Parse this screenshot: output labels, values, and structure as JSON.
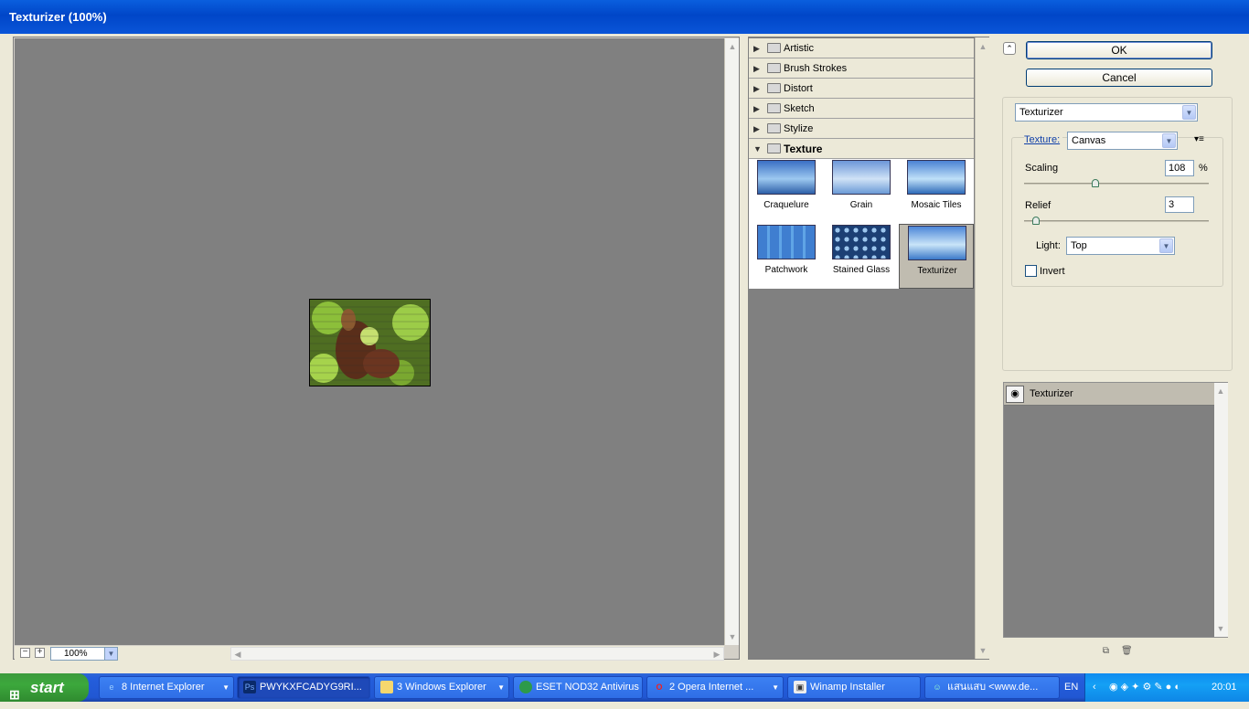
{
  "window": {
    "title": "Texturizer (100%)"
  },
  "preview": {
    "zoom": "100%"
  },
  "categories": [
    {
      "label": "Artistic"
    },
    {
      "label": "Brush Strokes"
    },
    {
      "label": "Distort"
    },
    {
      "label": "Sketch"
    },
    {
      "label": "Stylize"
    },
    {
      "label": "Texture"
    }
  ],
  "textures": [
    {
      "label": "Craquelure"
    },
    {
      "label": "Grain"
    },
    {
      "label": "Mosaic Tiles"
    },
    {
      "label": "Patchwork"
    },
    {
      "label": "Stained Glass"
    },
    {
      "label": "Texturizer"
    }
  ],
  "buttons": {
    "ok": "OK",
    "cancel": "Cancel"
  },
  "filter_select": {
    "value": "Texturizer"
  },
  "options": {
    "texture_label": "Texture:",
    "texture_value": "Canvas",
    "scaling_label": "Scaling",
    "scaling_value": "108",
    "scaling_unit": "%",
    "relief_label": "Relief",
    "relief_value": "3",
    "light_label": "Light:",
    "light_value": "Top",
    "invert_label": "Invert",
    "invert_checked": false
  },
  "layers": [
    {
      "label": "Texturizer"
    }
  ],
  "taskbar": {
    "start": "start",
    "tasks": [
      {
        "label": "8 Internet Explorer"
      },
      {
        "label": "PWYKXFCADYG9RI..."
      },
      {
        "label": "3 Windows Explorer"
      },
      {
        "label": "ESET NOD32 Antivirus"
      },
      {
        "label": "2 Opera Internet ..."
      },
      {
        "label": "Winamp Installer"
      },
      {
        "label": "แสนแสบ <www.de..."
      }
    ],
    "lang": "EN",
    "clock": "20:01"
  }
}
